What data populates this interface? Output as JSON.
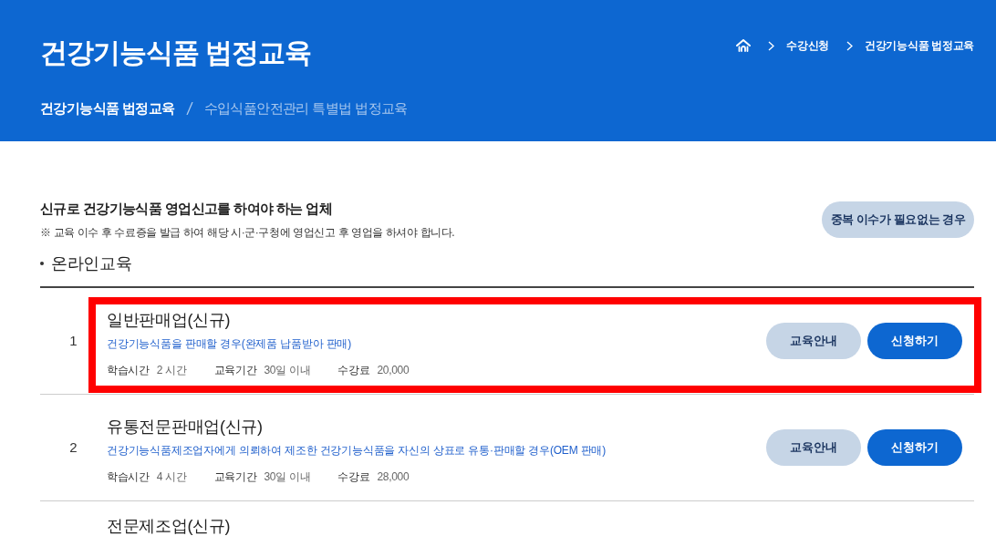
{
  "header": {
    "title": "건강기능식품 법정교육",
    "breadcrumb": [
      {
        "label": "수강신청"
      },
      {
        "label": "건강기능식품 법정교육"
      }
    ],
    "tabs": [
      {
        "label": "건강기능식품 법정교육",
        "selected": true
      },
      {
        "label": "수입식품안전관리 특별법 법정교육",
        "selected": false
      }
    ]
  },
  "section": {
    "heading": "신규로 건강기능식품 영업신고를 하여야 하는 업체",
    "note": "※ 교육 이수 후 수료증을 발급 하여 해당 시·군·구청에 영업신고 후 영업을 하셔야 합니다.",
    "side_button": "중복 이수가 필요없는 경우"
  },
  "subsection": {
    "title": "온라인교육"
  },
  "courses": [
    {
      "number": "1",
      "title": "일반판매업(신규)",
      "description": "건강기능식품을 판매할 경우(완제품 납품받아 판매)",
      "meta": [
        {
          "label": "학습시간",
          "value": "2 시간"
        },
        {
          "label": "교육기간",
          "value": "30일 이내"
        },
        {
          "label": "수강료",
          "value": "20,000"
        }
      ],
      "buttons": [
        {
          "label": "교육안내",
          "kind": "secondary"
        },
        {
          "label": "신청하기",
          "kind": "primary"
        }
      ],
      "highlighted": true
    },
    {
      "number": "2",
      "title": "유통전문판매업(신규)",
      "description": "건강기능식품제조업자에게 의뢰하여 제조한 건강기능식품을 자신의 상표로 유통·판매할 경우(OEM 판매)",
      "meta": [
        {
          "label": "학습시간",
          "value": "4 시간"
        },
        {
          "label": "교육기간",
          "value": "30일 이내"
        },
        {
          "label": "수강료",
          "value": "28,000"
        }
      ],
      "buttons": [
        {
          "label": "교육안내",
          "kind": "secondary"
        },
        {
          "label": "신청하기",
          "kind": "primary"
        }
      ],
      "highlighted": false
    },
    {
      "title": "전문제조업(신규)",
      "highlighted": false
    }
  ]
}
